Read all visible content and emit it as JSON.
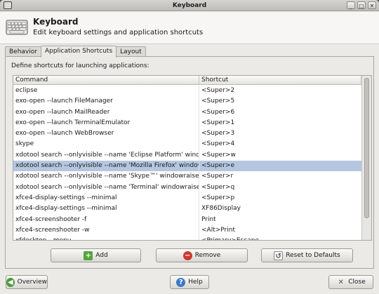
{
  "window": {
    "title": "Keyboard",
    "controls": [
      "_",
      "□",
      "✕"
    ]
  },
  "header": {
    "title": "Keyboard",
    "subtitle": "Edit keyboard settings and application shortcuts"
  },
  "tabs": [
    {
      "label": "Behavior",
      "active": false
    },
    {
      "label": "Application Shortcuts",
      "active": true
    },
    {
      "label": "Layout",
      "active": false
    }
  ],
  "panel": {
    "description": "Define shortcuts for launching applications:",
    "columns": {
      "command": "Command",
      "shortcut": "Shortcut"
    },
    "rows": [
      {
        "command": "eclipse",
        "shortcut": "<Super>2"
      },
      {
        "command": "exo-open --launch FileManager",
        "shortcut": "<Super>5"
      },
      {
        "command": "exo-open --launch MailReader",
        "shortcut": "<Super>6"
      },
      {
        "command": "exo-open --launch TerminalEmulator",
        "shortcut": "<Super>1"
      },
      {
        "command": "exo-open --launch WebBrowser",
        "shortcut": "<Super>3"
      },
      {
        "command": "skype",
        "shortcut": "<Super>4"
      },
      {
        "command": "xdotool search --onlyvisible --name 'Eclipse Platform' windowraise",
        "shortcut": "<Super>w"
      },
      {
        "command": "xdotool search --onlyvisible --name 'Mozilla Firefox' windowraise",
        "shortcut": "<Super>e",
        "selected": true
      },
      {
        "command": "xdotool search --onlyvisible --name 'Skype™' windowraise",
        "shortcut": "<Super>r"
      },
      {
        "command": "xdotool search --onlyvisible --name 'Terminal' windowraise",
        "shortcut": "<Super>q"
      },
      {
        "command": "xfce4-display-settings --minimal",
        "shortcut": "<Super>p"
      },
      {
        "command": "xfce4-display-settings --minimal",
        "shortcut": "XF86Display"
      },
      {
        "command": "xfce4-screenshooter -f",
        "shortcut": "Print"
      },
      {
        "command": "xfce4-screenshooter -w",
        "shortcut": "<Alt>Print"
      },
      {
        "command": "xfdesktop --menu",
        "shortcut": "<Primary>Escape"
      }
    ],
    "buttons": {
      "add": "Add",
      "remove": "Remove",
      "reset": "Reset to Defaults"
    }
  },
  "footer": {
    "overview": "Overview",
    "help": "Help",
    "close": "Close"
  },
  "icons": {
    "add": "plus-icon",
    "remove": "minus-icon",
    "reset": "reset-icon",
    "overview": "back-arrow-icon",
    "help": "help-icon",
    "close": "close-icon"
  },
  "colors": {
    "selection": "#b5c7df",
    "window_bg": "#eceae6"
  }
}
